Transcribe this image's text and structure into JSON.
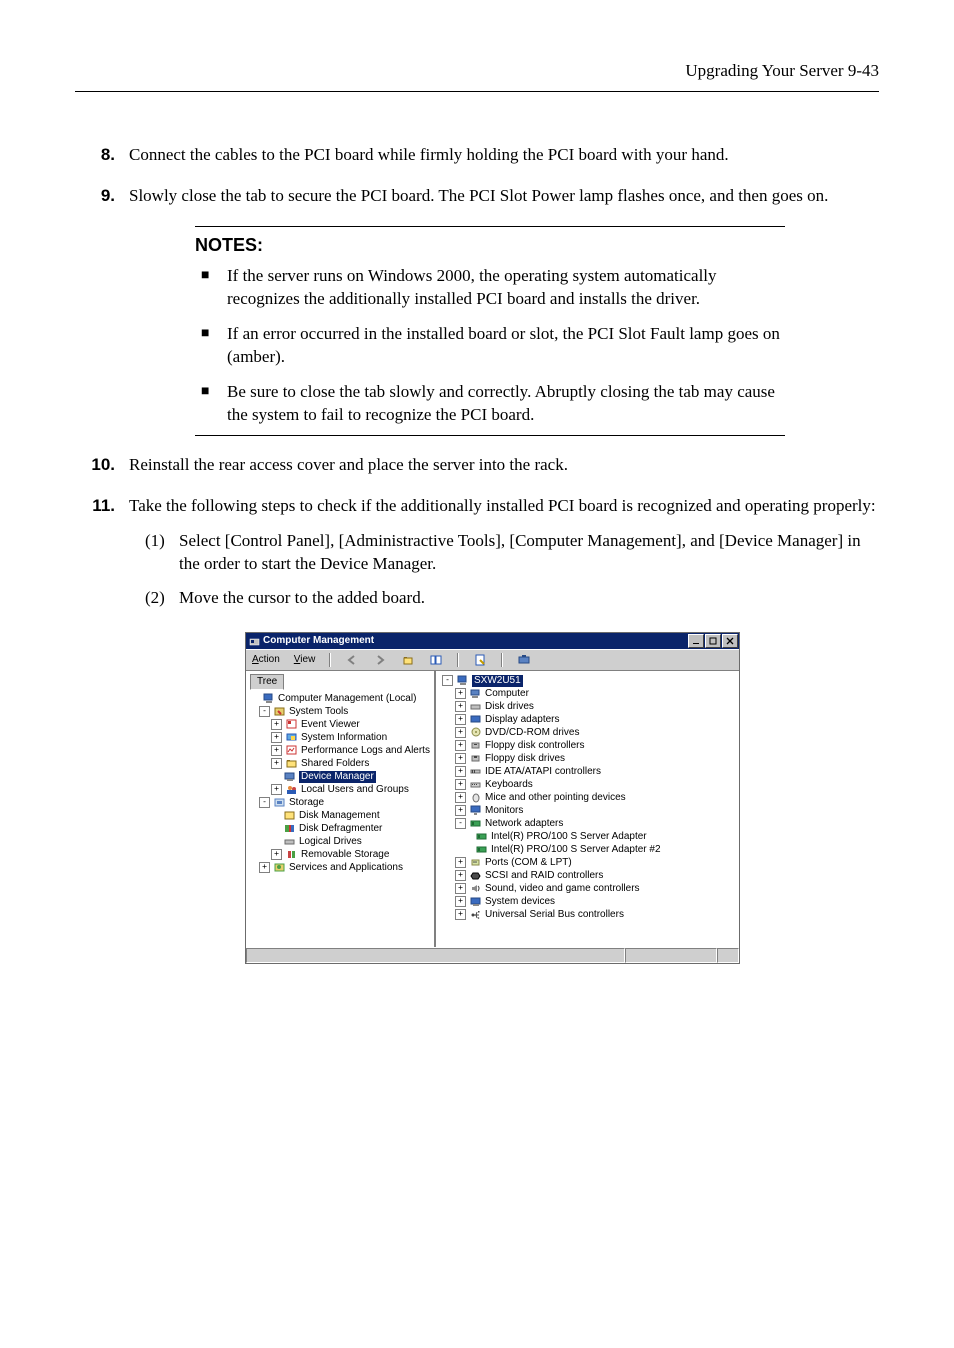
{
  "header": "Upgrading Your Server   9-43",
  "steps": {
    "s8": {
      "num": "8.",
      "text": "Connect the cables to the PCI board while firmly holding the PCI board with your hand."
    },
    "s9": {
      "num": "9.",
      "text": "Slowly close the tab to secure the PCI board. The PCI Slot Power lamp flashes once, and then goes on."
    },
    "s10": {
      "num": "10.",
      "text": "Reinstall the rear access cover and place the server into the rack."
    },
    "s11": {
      "num": "11.",
      "text": "Take the following steps to check if the additionally installed PCI board is recognized and operating properly:"
    }
  },
  "notes": {
    "title": "NOTES:",
    "items": [
      "If the server runs on Windows 2000, the operating system automatically recognizes the additionally installed PCI board and installs the driver.",
      "If an error occurred in the installed board or slot, the PCI Slot Fault lamp goes on (amber).",
      "Be sure to close the tab slowly and correctly.   Abruptly closing the tab may cause the system to fail to recognize the PCI board."
    ]
  },
  "substeps": {
    "p1": {
      "paren": "(1)",
      "text": "Select [Control Panel], [Administractive Tools], [Computer Management], and [Device Manager] in the order to start the Device Manager."
    },
    "p2": {
      "paren": "(2)",
      "text": "Move the cursor to the added board."
    }
  },
  "mmc": {
    "title": "Computer Management",
    "menu": {
      "action": "Action",
      "view": "View"
    },
    "tree_tab": "Tree",
    "left_tree": {
      "root": "Computer Management (Local)",
      "system_tools": "System Tools",
      "event_viewer": "Event Viewer",
      "system_information": "System Information",
      "perf_logs": "Performance Logs and Alerts",
      "shared_folders": "Shared Folders",
      "device_manager": "Device Manager",
      "local_users": "Local Users and Groups",
      "storage": "Storage",
      "disk_management": "Disk Management",
      "disk_defrag": "Disk Defragmenter",
      "logical_drives": "Logical Drives",
      "removable_storage": "Removable Storage",
      "services": "Services and Applications"
    },
    "right_tree": {
      "root": "SXW2U51",
      "computer": "Computer",
      "disk_drives": "Disk drives",
      "display": "Display adapters",
      "dvd": "DVD/CD-ROM drives",
      "fdc": "Floppy disk controllers",
      "fdd": "Floppy disk drives",
      "ide": "IDE ATA/ATAPI controllers",
      "keyboards": "Keyboards",
      "mice": "Mice and other pointing devices",
      "monitors": "Monitors",
      "network": "Network adapters",
      "nic1": "Intel(R) PRO/100 S Server Adapter",
      "nic2": "Intel(R) PRO/100 S Server Adapter #2",
      "ports": "Ports (COM & LPT)",
      "scsi": "SCSI and RAID controllers",
      "sound": "Sound, video and game controllers",
      "sysdev": "System devices",
      "usb": "Universal Serial Bus controllers"
    }
  }
}
